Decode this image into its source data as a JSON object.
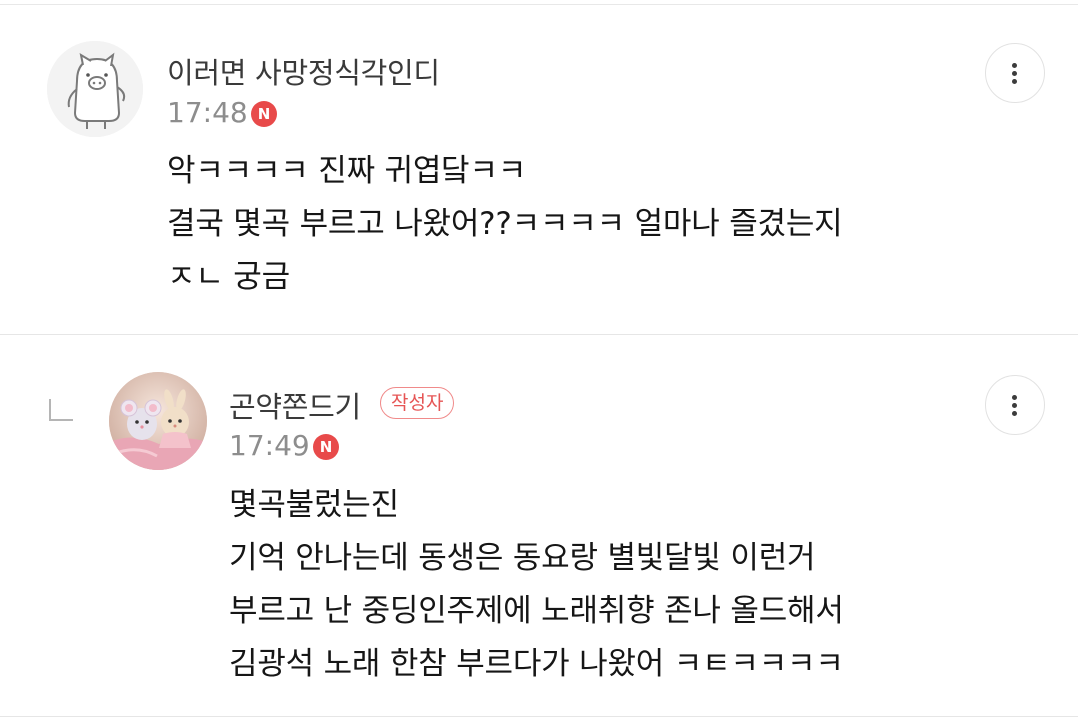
{
  "comments": [
    {
      "nickname": "이러면 사망정식각인디",
      "time": "17:48",
      "new_badge": "N",
      "lines": [
        "악ㅋㅋㅋㅋ 진짜 귀엽닼ㅋㅋ",
        "결국 몇곡 부르고 나왔어??ㅋㅋㅋㅋ 얼마나 즐겼는지",
        "ㅈㄴ 궁금"
      ],
      "avatar_icon": "pig-character-avatar"
    },
    {
      "nickname": "곤약쫀드기",
      "author_badge": "작성자",
      "time": "17:49",
      "new_badge": "N",
      "lines": [
        "몇곡불렀는진",
        "기억 안나는데 동생은 동요랑 별빛달빛 이런거",
        "부르고 난 중딩인주제에 노래취향 존나 올드해서",
        "김광석 노래 한참 부르다가 나왔어 ㅋㅌㅋㅋㅋㅋ"
      ],
      "avatar_icon": "mouse-and-rabbit-figurine-avatar",
      "reply_icon": "reply-arrow-icon"
    }
  ],
  "colors": {
    "new_badge": "#e84a4a",
    "author_badge_border": "#f08a8a",
    "author_badge_text": "#e65555",
    "time": "#8d8d8d"
  },
  "icons": {
    "more": "more-vertical-icon"
  }
}
